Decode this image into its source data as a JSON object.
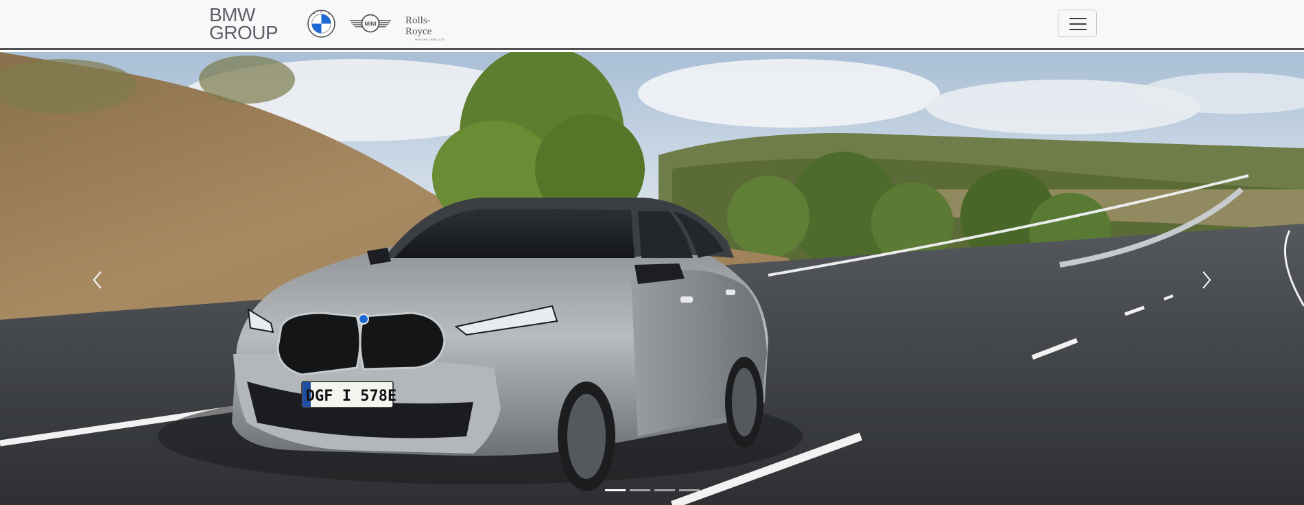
{
  "header": {
    "brand_line1": "BMW",
    "brand_line2": "GROUP",
    "logos": [
      {
        "name": "bmw-logo",
        "alt": "BMW"
      },
      {
        "name": "mini-logo",
        "alt": "MINI"
      },
      {
        "name": "rolls-royce-logo",
        "text": "Rolls-Royce",
        "subtext": "MOTOR CARS LTD"
      }
    ],
    "menu_icon": "hamburger-icon"
  },
  "hero": {
    "image_subject": "car-on-highway",
    "license_plate": "DGF I 578E",
    "prev_icon": "chevron-left-icon",
    "next_icon": "chevron-right-icon",
    "slide_count": 4,
    "active_slide": 1
  },
  "colors": {
    "navbar_bg": "#f7f8fa",
    "navbar_border": "#4f4f4f",
    "brand_text": "#5d5f63",
    "bmw_blue": "#1c69d4"
  }
}
